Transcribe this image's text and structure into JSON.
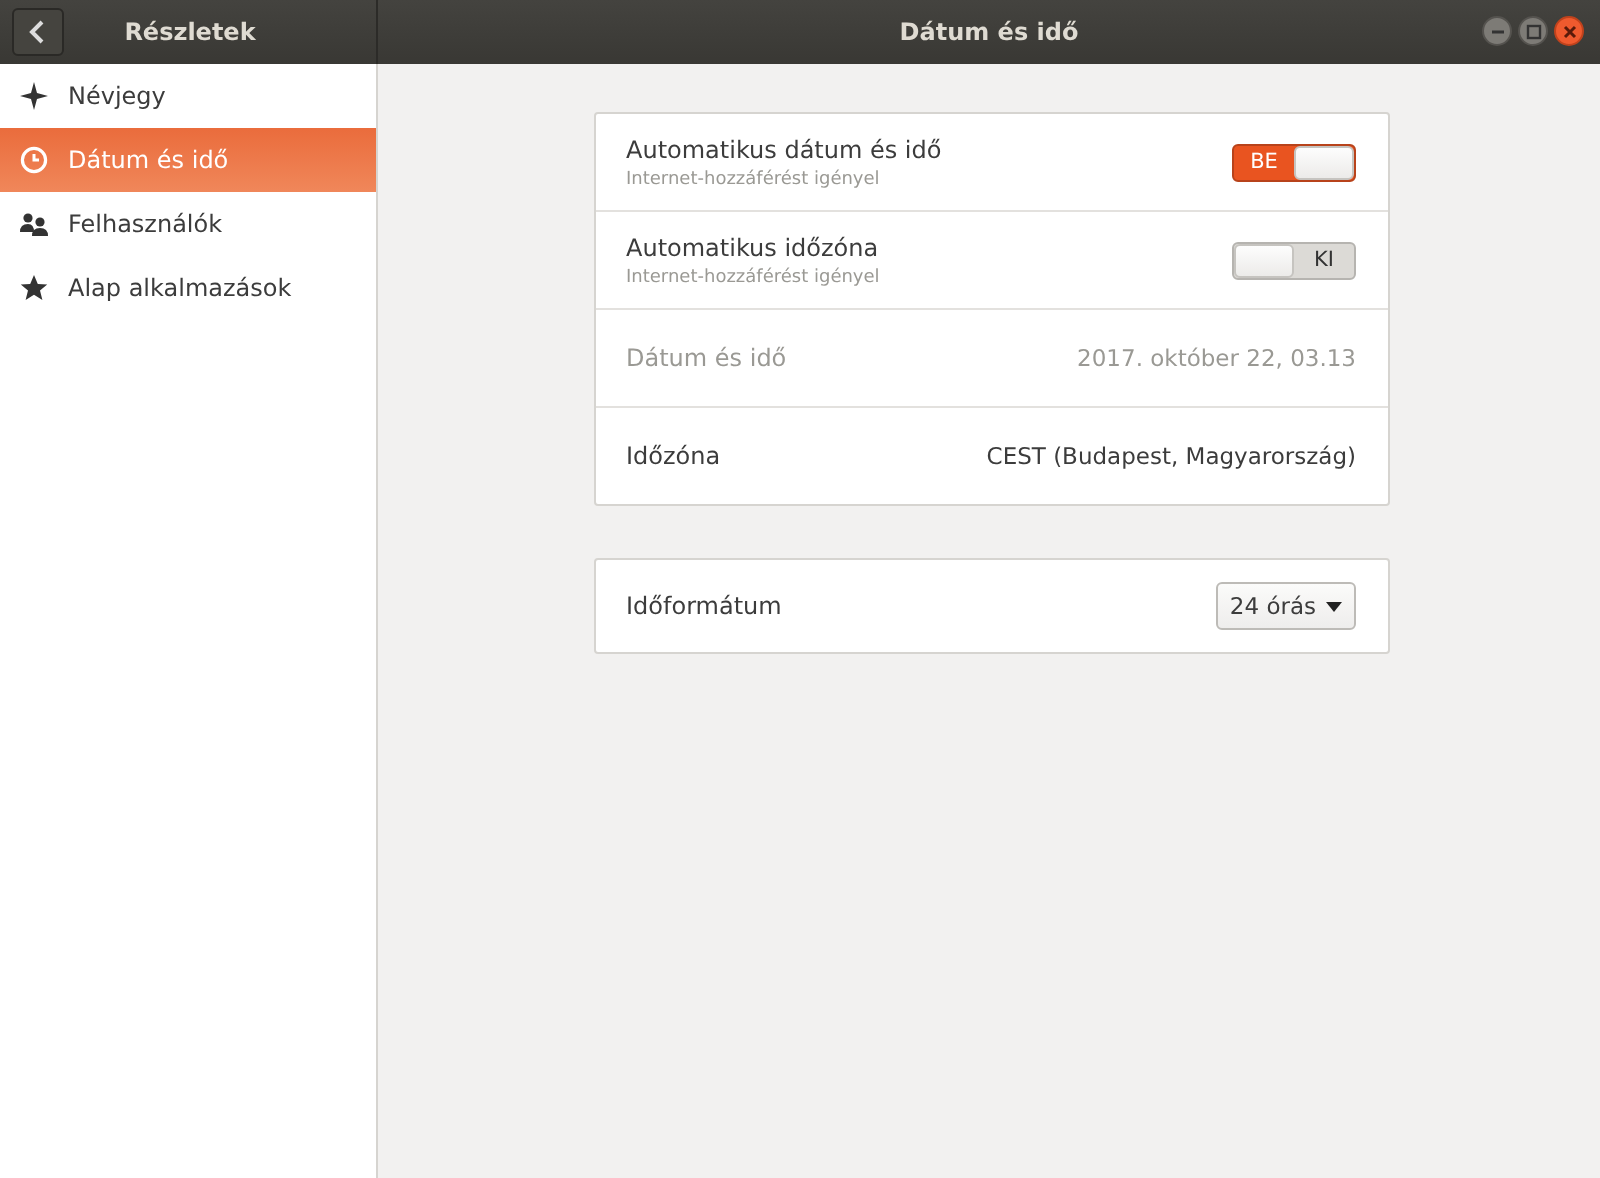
{
  "header": {
    "back_title": "Részletek",
    "title": "Dátum és idő"
  },
  "sidebar": {
    "items": [
      {
        "label": "Névjegy",
        "selected": false
      },
      {
        "label": "Dátum és idő",
        "selected": true
      },
      {
        "label": "Felhasználók",
        "selected": false
      },
      {
        "label": "Alap alkalmazások",
        "selected": false
      }
    ]
  },
  "sections": [
    {
      "rows": [
        {
          "kind": "switch",
          "label": "Automatikus dátum és idő",
          "subtitle": "Internet-hozzáférést igényel",
          "switch": {
            "on": true,
            "label": "BE"
          },
          "disabled": false
        },
        {
          "kind": "switch",
          "label": "Automatikus időzóna",
          "subtitle": "Internet-hozzáférést igényel",
          "switch": {
            "on": false,
            "label": "KI"
          },
          "disabled": false
        },
        {
          "kind": "value",
          "label": "Dátum és idő",
          "value": "2017. október 22, 03.13",
          "disabled": true
        },
        {
          "kind": "value",
          "label": "Időzóna",
          "value": "CEST (Budapest, Magyarország)",
          "disabled": false
        }
      ]
    },
    {
      "rows": [
        {
          "kind": "dropdown",
          "label": "Időformátum",
          "value": "24 órás",
          "disabled": false
        }
      ]
    }
  ]
}
